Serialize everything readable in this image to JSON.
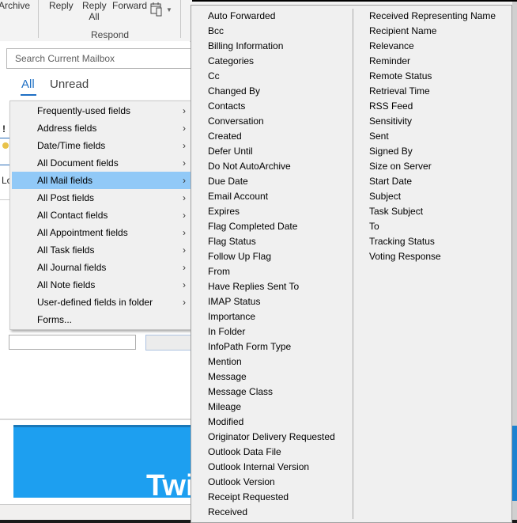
{
  "ribbon": {
    "archive_label": "Archive",
    "reply_label": "Reply",
    "reply_all_label_line1": "Reply",
    "reply_all_label_line2": "All",
    "forward_label": "Forward",
    "more_icon": "calendar-device-icon",
    "group_label": "Respond"
  },
  "search": {
    "placeholder": "Search Current Mailbox"
  },
  "filter_tabs": [
    {
      "label": "All",
      "active": true
    },
    {
      "label": "Unread",
      "active": false
    }
  ],
  "background": {
    "importance_mark": "!",
    "partial_text": "Lo",
    "banner_text": "Twi"
  },
  "colors": {
    "accent": "#1e6fc4",
    "menu_highlight": "#91c9f7",
    "menu_bg": "#f0f0f0",
    "banner": "#1d9ff0"
  },
  "context_menu": {
    "items": [
      {
        "label": "Frequently-used fields",
        "has_submenu": true
      },
      {
        "label": "Address fields",
        "has_submenu": true
      },
      {
        "label": "Date/Time fields",
        "has_submenu": true
      },
      {
        "label": "All Document fields",
        "has_submenu": true
      },
      {
        "label": "All Mail fields",
        "has_submenu": true,
        "active": true
      },
      {
        "label": "All Post fields",
        "has_submenu": true
      },
      {
        "label": "All Contact fields",
        "has_submenu": true
      },
      {
        "label": "All Appointment fields",
        "has_submenu": true
      },
      {
        "label": "All Task fields",
        "has_submenu": true
      },
      {
        "label": "All Journal fields",
        "has_submenu": true
      },
      {
        "label": "All Note fields",
        "has_submenu": true
      },
      {
        "label": "User-defined fields in folder",
        "has_submenu": true
      },
      {
        "label": "Forms...",
        "has_submenu": false
      }
    ],
    "chevron": "›"
  },
  "submenu": {
    "title": "All Mail fields",
    "column1": [
      "Auto Forwarded",
      "Bcc",
      "Billing Information",
      "Categories",
      "Cc",
      "Changed By",
      "Contacts",
      "Conversation",
      "Created",
      "Defer Until",
      "Do Not AutoArchive",
      "Due Date",
      "Email Account",
      "Expires",
      "Flag Completed Date",
      "Flag Status",
      "Follow Up Flag",
      "From",
      "Have Replies Sent To",
      "IMAP Status",
      "Importance",
      "In Folder",
      "InfoPath Form Type",
      "Mention",
      "Message",
      "Message Class",
      "Mileage",
      "Modified",
      "Originator Delivery Requested",
      "Outlook Data File",
      "Outlook Internal Version",
      "Outlook Version",
      "Receipt Requested",
      "Received"
    ],
    "column2": [
      "Received Representing Name",
      "Recipient Name",
      "Relevance",
      "Reminder",
      "Remote Status",
      "Retrieval Time",
      "RSS Feed",
      "Sensitivity",
      "Sent",
      "Signed By",
      "Size on Server",
      "Start Date",
      "Subject",
      "Task Subject",
      "To",
      "Tracking Status",
      "Voting Response"
    ]
  }
}
